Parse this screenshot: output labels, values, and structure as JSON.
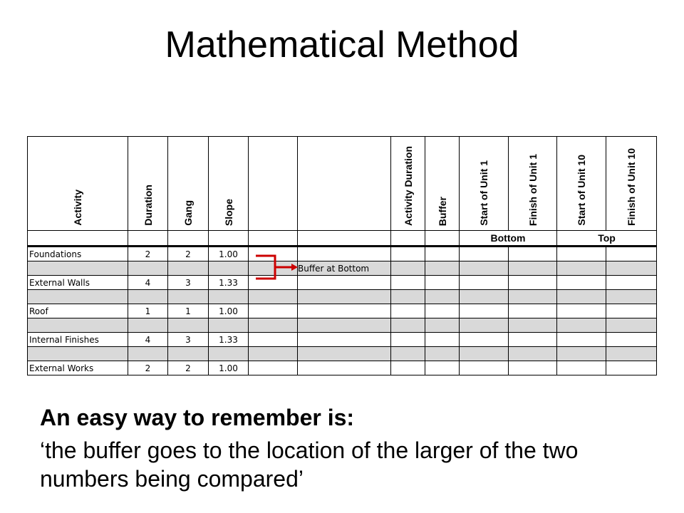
{
  "title": "Mathematical Method",
  "table": {
    "headers": {
      "activity": "Activity",
      "duration": "Duration",
      "gang": "Gang",
      "slope": "Slope",
      "blank1": "",
      "blank2": "",
      "activity_duration": "Activity Duration",
      "buffer": "Buffer",
      "start_unit1": "Start of Unit 1",
      "finish_unit1": "Finish of Unit 1",
      "start_unit10": "Start of Unit 10",
      "finish_unit10": "Finish of Unit 10"
    },
    "group_labels": {
      "bottom": "Bottom",
      "top": "Top"
    },
    "rows": [
      {
        "activity": "Foundations",
        "duration": "2",
        "gang": "2",
        "slope": "1.00"
      },
      {
        "activity": "External Walls",
        "duration": "4",
        "gang": "3",
        "slope": "1.33"
      },
      {
        "activity": "Roof",
        "duration": "1",
        "gang": "1",
        "slope": "1.00"
      },
      {
        "activity": "Internal Finishes",
        "duration": "4",
        "gang": "3",
        "slope": "1.33"
      },
      {
        "activity": "External Works",
        "duration": "2",
        "gang": "2",
        "slope": "1.00"
      }
    ],
    "annotation": "Buffer at Bottom",
    "annotation_color": "#cc0000",
    "shade_color": "#d9d9d9"
  },
  "text": {
    "line1": "An easy way to remember is:",
    "line2": "‘the buffer goes to the location of the larger of the two numbers being compared’"
  }
}
